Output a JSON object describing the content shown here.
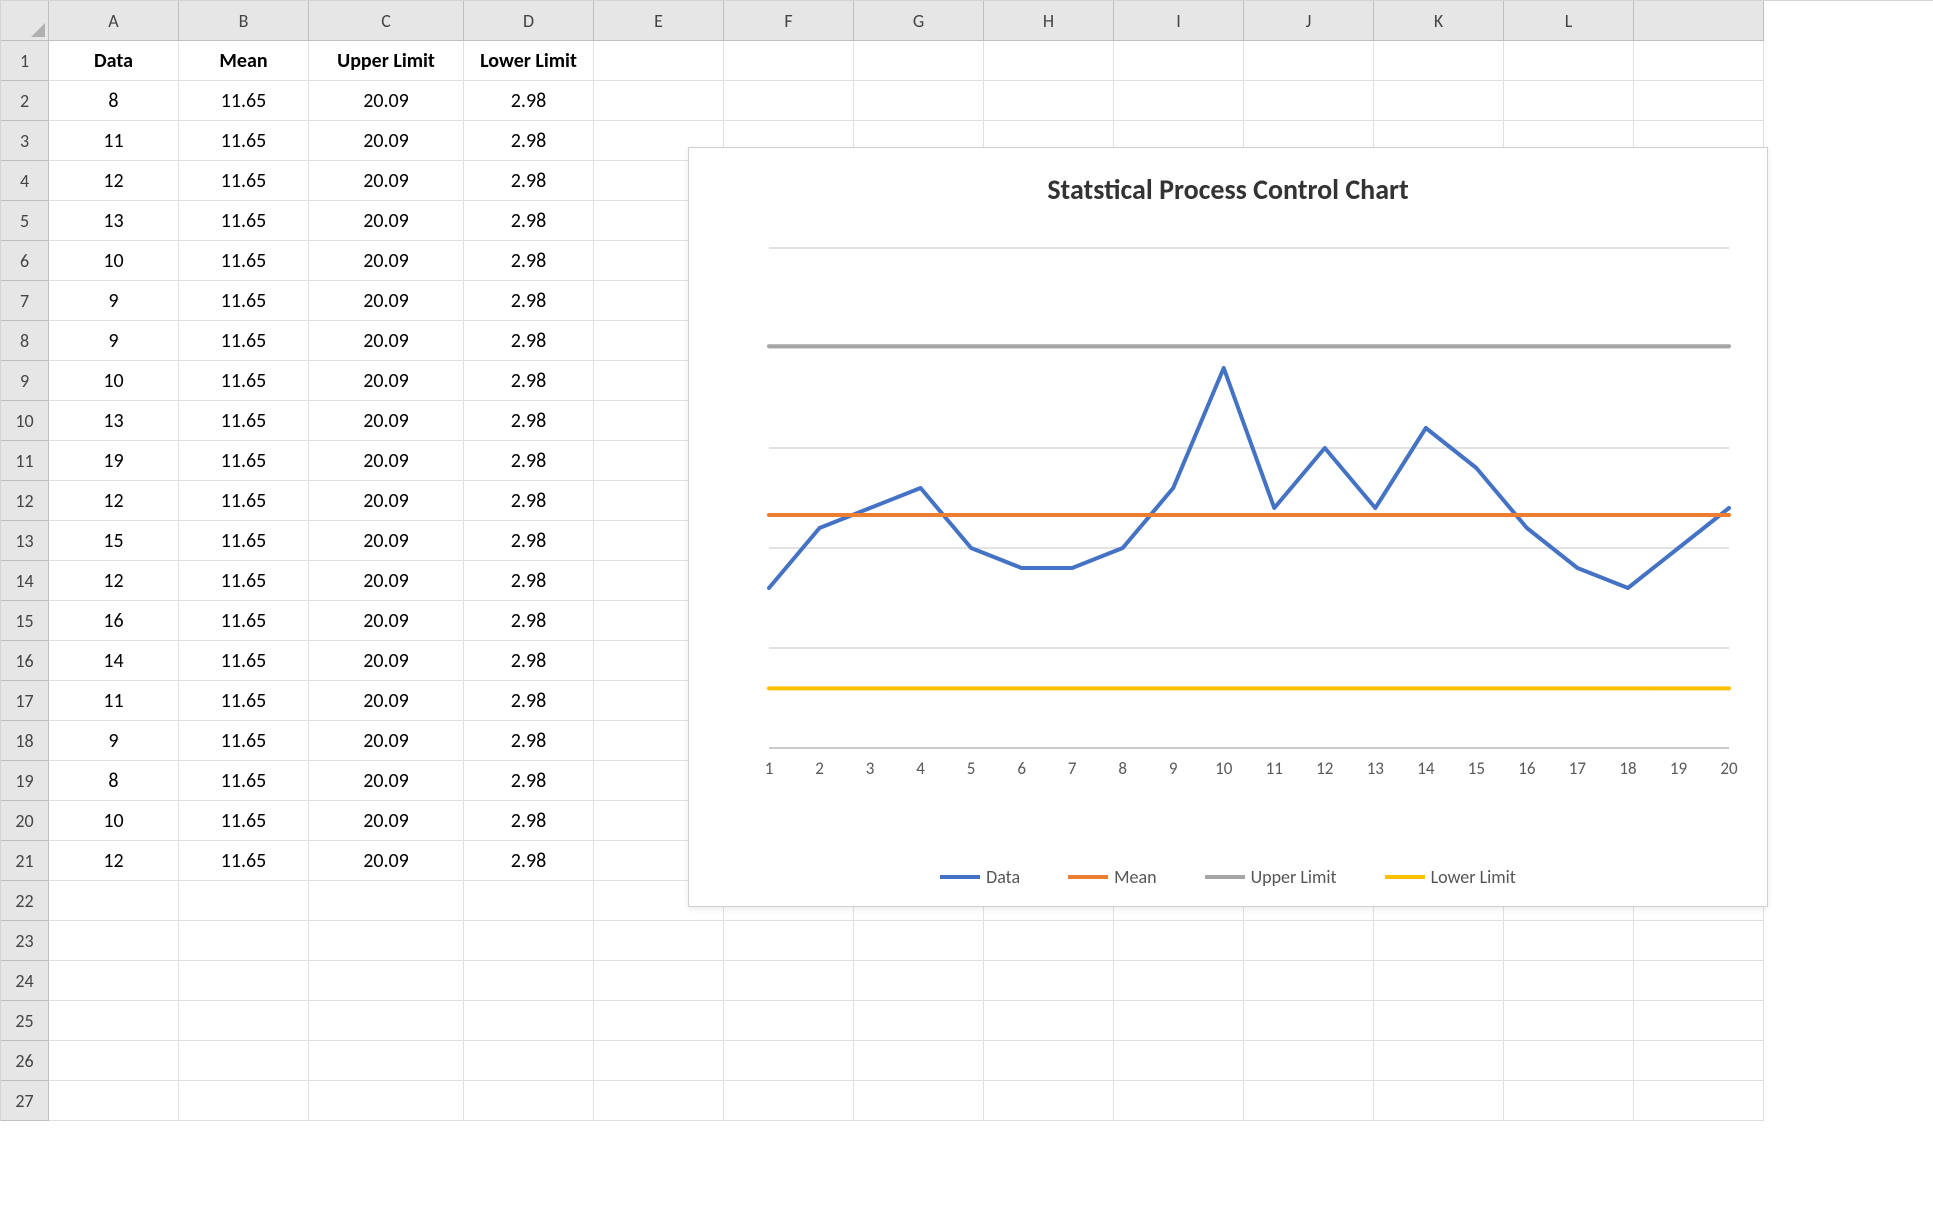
{
  "columns": [
    "A",
    "B",
    "C",
    "D",
    "E",
    "F",
    "G",
    "H",
    "I",
    "J",
    "K",
    "L"
  ],
  "row_count": 27,
  "headers": {
    "A": "Data",
    "B": "Mean",
    "C": "Upper Limit",
    "D": "Lower Limit"
  },
  "data_rows": [
    {
      "A": "8",
      "B": "11.65",
      "C": "20.09",
      "D": "2.98"
    },
    {
      "A": "11",
      "B": "11.65",
      "C": "20.09",
      "D": "2.98"
    },
    {
      "A": "12",
      "B": "11.65",
      "C": "20.09",
      "D": "2.98"
    },
    {
      "A": "13",
      "B": "11.65",
      "C": "20.09",
      "D": "2.98"
    },
    {
      "A": "10",
      "B": "11.65",
      "C": "20.09",
      "D": "2.98"
    },
    {
      "A": "9",
      "B": "11.65",
      "C": "20.09",
      "D": "2.98"
    },
    {
      "A": "9",
      "B": "11.65",
      "C": "20.09",
      "D": "2.98"
    },
    {
      "A": "10",
      "B": "11.65",
      "C": "20.09",
      "D": "2.98"
    },
    {
      "A": "13",
      "B": "11.65",
      "C": "20.09",
      "D": "2.98"
    },
    {
      "A": "19",
      "B": "11.65",
      "C": "20.09",
      "D": "2.98"
    },
    {
      "A": "12",
      "B": "11.65",
      "C": "20.09",
      "D": "2.98"
    },
    {
      "A": "15",
      "B": "11.65",
      "C": "20.09",
      "D": "2.98"
    },
    {
      "A": "12",
      "B": "11.65",
      "C": "20.09",
      "D": "2.98"
    },
    {
      "A": "16",
      "B": "11.65",
      "C": "20.09",
      "D": "2.98"
    },
    {
      "A": "14",
      "B": "11.65",
      "C": "20.09",
      "D": "2.98"
    },
    {
      "A": "11",
      "B": "11.65",
      "C": "20.09",
      "D": "2.98"
    },
    {
      "A": "9",
      "B": "11.65",
      "C": "20.09",
      "D": "2.98"
    },
    {
      "A": "8",
      "B": "11.65",
      "C": "20.09",
      "D": "2.98"
    },
    {
      "A": "10",
      "B": "11.65",
      "C": "20.09",
      "D": "2.98"
    },
    {
      "A": "12",
      "B": "11.65",
      "C": "20.09",
      "D": "2.98"
    }
  ],
  "chart": {
    "title": "Statstical Process Control Chart",
    "legend": [
      "Data",
      "Mean",
      "Upper Limit",
      "Lower Limit"
    ],
    "colors": {
      "data": "#4472c4",
      "mean": "#ed7d31",
      "upper": "#a5a5a5",
      "lower": "#ffc000",
      "grid": "#d9d9d9",
      "axis": "#bfbfbf",
      "text": "#595959"
    }
  },
  "chart_data": {
    "type": "line",
    "title": "Statstical Process Control Chart",
    "xlabel": "",
    "ylabel": "",
    "x": [
      1,
      2,
      3,
      4,
      5,
      6,
      7,
      8,
      9,
      10,
      11,
      12,
      13,
      14,
      15,
      16,
      17,
      18,
      19,
      20
    ],
    "xlim": [
      1,
      20
    ],
    "ylim": [
      0,
      25
    ],
    "yticks": [
      0,
      5,
      10,
      15,
      20,
      25
    ],
    "series": [
      {
        "name": "Data",
        "values": [
          8,
          11,
          12,
          13,
          10,
          9,
          9,
          10,
          13,
          19,
          12,
          15,
          12,
          16,
          14,
          11,
          9,
          8,
          10,
          12
        ],
        "color": "#4472c4"
      },
      {
        "name": "Mean",
        "values": [
          11.65,
          11.65,
          11.65,
          11.65,
          11.65,
          11.65,
          11.65,
          11.65,
          11.65,
          11.65,
          11.65,
          11.65,
          11.65,
          11.65,
          11.65,
          11.65,
          11.65,
          11.65,
          11.65,
          11.65
        ],
        "color": "#ed7d31"
      },
      {
        "name": "Upper Limit",
        "values": [
          20.09,
          20.09,
          20.09,
          20.09,
          20.09,
          20.09,
          20.09,
          20.09,
          20.09,
          20.09,
          20.09,
          20.09,
          20.09,
          20.09,
          20.09,
          20.09,
          20.09,
          20.09,
          20.09,
          20.09
        ],
        "color": "#a5a5a5"
      },
      {
        "name": "Lower Limit",
        "values": [
          2.98,
          2.98,
          2.98,
          2.98,
          2.98,
          2.98,
          2.98,
          2.98,
          2.98,
          2.98,
          2.98,
          2.98,
          2.98,
          2.98,
          2.98,
          2.98,
          2.98,
          2.98,
          2.98,
          2.98
        ],
        "color": "#ffc000"
      }
    ]
  }
}
